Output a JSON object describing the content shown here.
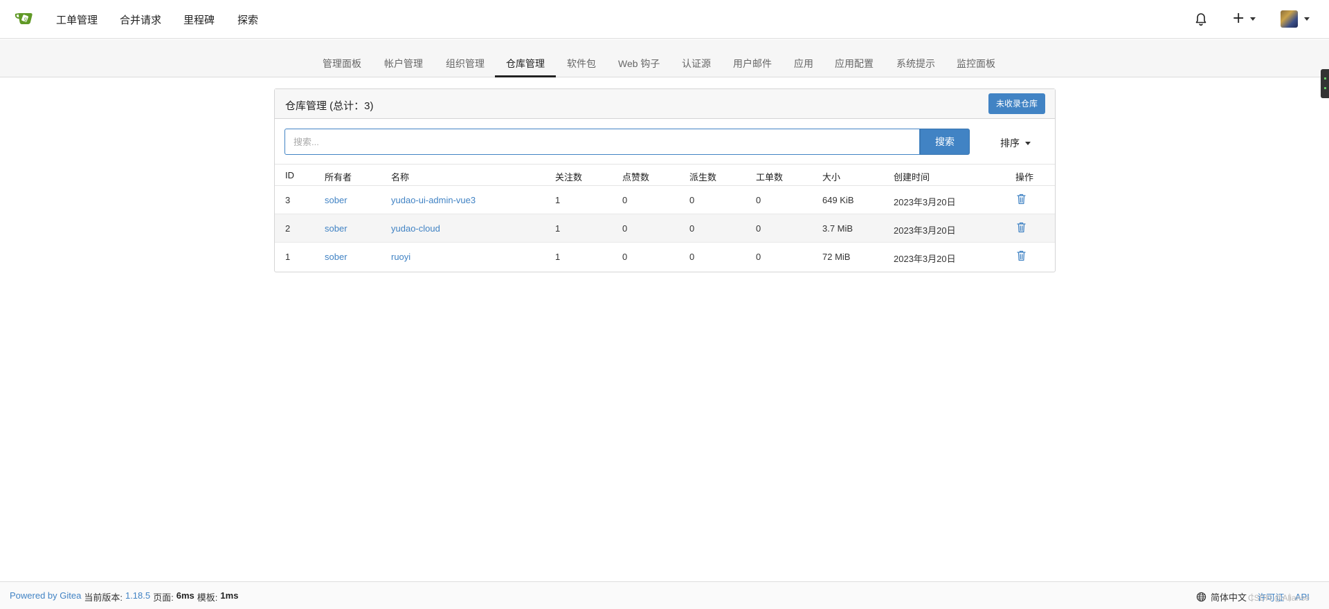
{
  "navbar": {
    "items": [
      "工单管理",
      "合并请求",
      "里程碑",
      "探索"
    ]
  },
  "subnav": {
    "items": [
      "管理面板",
      "帐户管理",
      "组织管理",
      "仓库管理",
      "软件包",
      "Web 钩子",
      "认证源",
      "用户邮件",
      "应用",
      "应用配置",
      "系统提示",
      "监控面板"
    ],
    "active": "仓库管理"
  },
  "panel": {
    "title": "仓库管理 (总计：3)",
    "unadopted_button": "未收录仓库"
  },
  "search": {
    "placeholder": "搜索...",
    "button": "搜索",
    "sort_label": "排序"
  },
  "table": {
    "headers": [
      "ID",
      "所有者",
      "名称",
      "关注数",
      "点赞数",
      "派生数",
      "工单数",
      "大小",
      "创建时间",
      "操作"
    ],
    "rows": [
      {
        "id": "3",
        "owner": "sober",
        "name": "yudao-ui-admin-vue3",
        "watches": "1",
        "stars": "0",
        "forks": "0",
        "issues": "0",
        "size": "649 KiB",
        "created": "2023年3月20日"
      },
      {
        "id": "2",
        "owner": "sober",
        "name": "yudao-cloud",
        "watches": "1",
        "stars": "0",
        "forks": "0",
        "issues": "0",
        "size": "3.7 MiB",
        "created": "2023年3月20日"
      },
      {
        "id": "1",
        "owner": "sober",
        "name": "ruoyi",
        "watches": "1",
        "stars": "0",
        "forks": "0",
        "issues": "0",
        "size": "72 MiB",
        "created": "2023年3月20日"
      }
    ]
  },
  "footer": {
    "powered_by": "Powered by Gitea",
    "version_label": "当前版本:",
    "version": "1.18.5",
    "page_label": "页面:",
    "page_time": "6ms",
    "template_label": "模板:",
    "template_time": "1ms",
    "language": "简体中文",
    "license": "许可证",
    "api": "API",
    "watermark": "CSDN @Alianse"
  },
  "colors": {
    "primary": "#4183c4",
    "logo_green": "#609926"
  },
  "icons": {
    "logo": "gitea-logo-icon",
    "bell": "bell-icon",
    "plus": "plus-icon",
    "trash": "trash-icon",
    "globe": "globe-icon"
  }
}
